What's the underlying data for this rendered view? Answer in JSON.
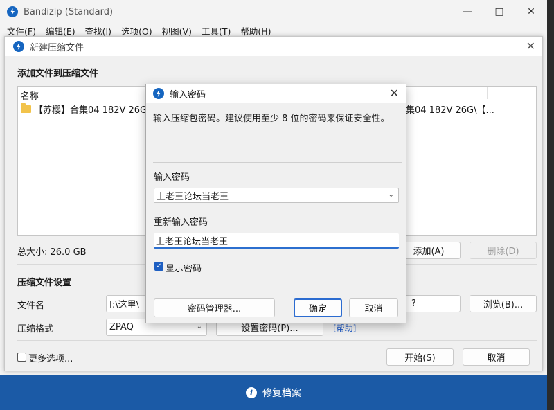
{
  "app": {
    "title": "Bandizip (Standard)",
    "menu": [
      "文件(F)",
      "编辑(E)",
      "查找(I)",
      "选项(O)",
      "视图(V)",
      "工具(T)",
      "帮助(H)"
    ],
    "window_buttons": [
      "minimize-icon",
      "maximize-icon",
      "close-icon"
    ],
    "bottom_action": "修复档案"
  },
  "new_archive": {
    "title": "新建压缩文件",
    "section_add": "添加文件到压缩文件",
    "list_header": "名称",
    "file_name": "【苏樱】合集04 182V 26G",
    "file_name_right": "集04 182V 26G\\【...",
    "total_size": "总大小: 26.0 GB",
    "add_button": "添加(A)",
    "delete_button": "删除(D)",
    "section_settings": "压缩文件设置",
    "filename_label": "文件名",
    "filename_value": "I:\\这里\\【",
    "filename_right_value": "?",
    "browse_button": "浏览(B)...",
    "format_label": "压缩格式",
    "format_value": "ZPAQ",
    "set_password_button": "设置密码(P)...",
    "help_link": "[帮助]",
    "more_options": "更多选项...",
    "start_button": "开始(S)",
    "cancel_button": "取消"
  },
  "password_dialog": {
    "title": "输入密码",
    "description": "输入压缩包密码。建议使用至少 8 位的密码来保证安全性。",
    "password_label": "输入密码",
    "password_value": "上老王论坛当老王",
    "confirm_label": "重新输入密码",
    "confirm_value": "上老王论坛当老王",
    "show_password_label": "显示密码",
    "show_password_checked": true,
    "manager_button": "密码管理器...",
    "ok_button": "确定",
    "cancel_button": "取消"
  },
  "colors": {
    "accent": "#1e5fc2",
    "bottom_bar": "#1b5aa6"
  }
}
